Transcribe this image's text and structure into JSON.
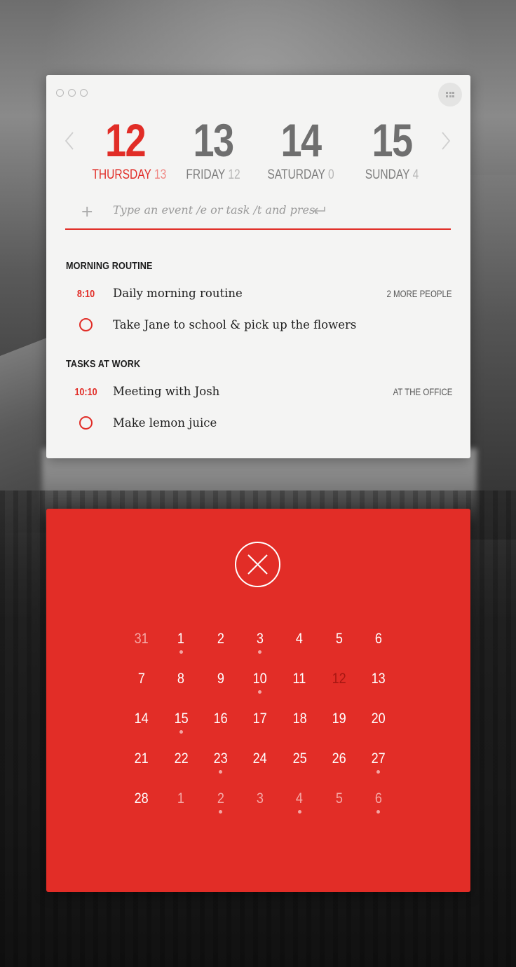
{
  "header": {
    "days": [
      {
        "day": "12",
        "label": "THURSDAY",
        "count": "13",
        "active": true
      },
      {
        "day": "13",
        "label": "FRIDAY",
        "count": "12",
        "active": false
      },
      {
        "day": "14",
        "label": "SATURDAY",
        "count": "0",
        "active": false
      },
      {
        "day": "15",
        "label": "SUNDAY",
        "count": "4",
        "active": false
      }
    ]
  },
  "entry": {
    "plus": "+",
    "placeholder": "Type an event /e or task /t and press"
  },
  "sections": [
    {
      "title": "MORNING ROUTINE",
      "items": [
        {
          "time": "8:10",
          "title": "Daily morning routine",
          "meta": "2 MORE PEOPLE"
        },
        {
          "task": true,
          "title": "Take Jane to school & pick up the flowers"
        }
      ]
    },
    {
      "title": "TASKS AT WORK",
      "items": [
        {
          "time": "10:10",
          "title": "Meeting with Josh",
          "meta": "AT THE OFFICE"
        },
        {
          "task": true,
          "title": "Make lemon juice"
        }
      ]
    }
  ],
  "calendar": {
    "weeks": [
      [
        {
          "d": "31",
          "muted": true
        },
        {
          "d": "1",
          "dot": true
        },
        {
          "d": "2"
        },
        {
          "d": "3",
          "dot": true
        },
        {
          "d": "4"
        },
        {
          "d": "5"
        },
        {
          "d": "6"
        }
      ],
      [
        {
          "d": "7"
        },
        {
          "d": "8"
        },
        {
          "d": "9"
        },
        {
          "d": "10",
          "dot": true
        },
        {
          "d": "11"
        },
        {
          "d": "12",
          "today": true
        },
        {
          "d": "13"
        }
      ],
      [
        {
          "d": "14"
        },
        {
          "d": "15",
          "dot": true
        },
        {
          "d": "16"
        },
        {
          "d": "17"
        },
        {
          "d": "18"
        },
        {
          "d": "19"
        },
        {
          "d": "20"
        }
      ],
      [
        {
          "d": "21"
        },
        {
          "d": "22"
        },
        {
          "d": "23",
          "dot": true
        },
        {
          "d": "24"
        },
        {
          "d": "25"
        },
        {
          "d": "26"
        },
        {
          "d": "27",
          "dot": true
        }
      ],
      [
        {
          "d": "28"
        },
        {
          "d": "1",
          "muted": true
        },
        {
          "d": "2",
          "muted": true,
          "dot": true
        },
        {
          "d": "3",
          "muted": true
        },
        {
          "d": "4",
          "muted": true,
          "dot": true
        },
        {
          "d": "5",
          "muted": true
        },
        {
          "d": "6",
          "muted": true,
          "dot": true
        }
      ]
    ]
  },
  "colors": {
    "accent": "#e12d27",
    "panel": "#f4f4f3",
    "calendar_bg": "#e22d27"
  }
}
